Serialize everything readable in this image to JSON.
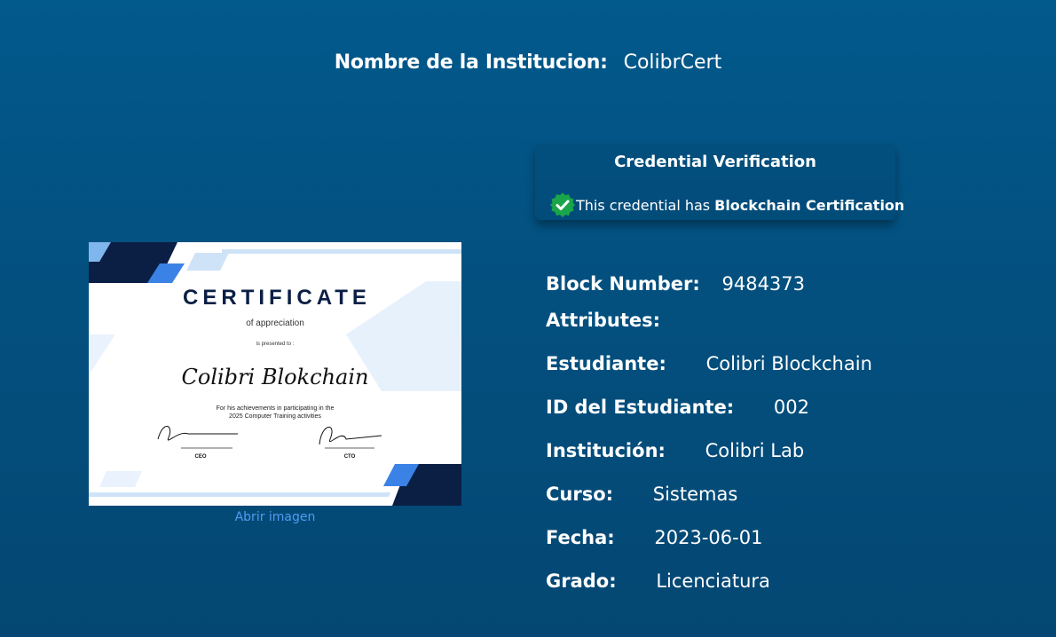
{
  "header": {
    "label": "Nombre de la Institucion:",
    "value": "ColibrCert"
  },
  "verification": {
    "title": "Credential Verification",
    "text": "This credential has",
    "strong": "Blockchain Certification",
    "icon": "verified-check-icon"
  },
  "certificate_image": {
    "heading": "CERTIFICATE",
    "subheading": "of appreciation",
    "presented": "is presented to :",
    "recipient": "Colibri Blokchain",
    "line1": "For his achievements in participating in the",
    "line2": "2025 Computer Training activities",
    "sign1": "CEO",
    "sign2": "CTO"
  },
  "open_image_link": "Abrir imagen",
  "block": {
    "label": "Block Number:",
    "value": "9484373"
  },
  "attributes_label": "Attributes:",
  "fields": [
    {
      "label": "Estudiante:",
      "value": "Colibri Blockchain"
    },
    {
      "label": "ID del Estudiante:",
      "value": "002"
    },
    {
      "label": "Institución:",
      "value": "Colibri Lab"
    },
    {
      "label": "Curso:",
      "value": "Sistemas"
    },
    {
      "label": "Fecha:",
      "value": "2023-06-01"
    },
    {
      "label": "Grado:",
      "value": "Licenciatura"
    }
  ],
  "colors": {
    "background": "#03507f",
    "link": "#4f9bf2",
    "badge": "#1aa54a",
    "cert_navy": "#0b1f45",
    "cert_blue": "#3b82e6"
  }
}
